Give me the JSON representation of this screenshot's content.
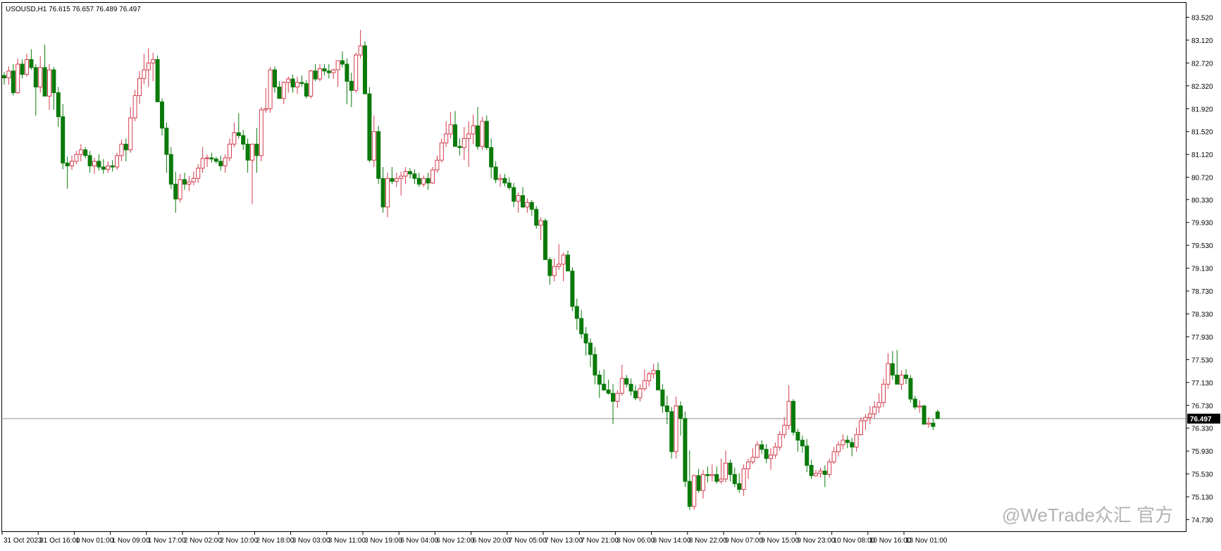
{
  "header": {
    "symbol": "USOUSD,H1",
    "ohlc": "76.615 76.657 76.489 76.497"
  },
  "watermark": {
    "text": "@WeTrade众汇 官方"
  },
  "colors": {
    "bull": "#d33a4b",
    "bear": "#0a7a0a",
    "axis": "#000000",
    "price_line": "#8c8c8c",
    "price_label_bg": "#000000",
    "price_label_fg": "#ffffff"
  },
  "chart_data": {
    "type": "candlestick",
    "title": "USOUSD,H1",
    "ylim": [
      74.73,
      83.52
    ],
    "yticks": [
      "83.520",
      "83.120",
      "82.720",
      "82.320",
      "81.920",
      "81.520",
      "81.120",
      "80.720",
      "80.330",
      "79.930",
      "79.530",
      "79.130",
      "78.730",
      "78.330",
      "77.930",
      "77.530",
      "77.130",
      "76.730",
      "76.330",
      "75.930",
      "75.530",
      "75.130",
      "74.730"
    ],
    "xticks": [
      {
        "label": "31 Oct 2023",
        "index": 0
      },
      {
        "label": "31 Oct 16:00",
        "index": 8
      },
      {
        "label": "1 Nov 01:00",
        "index": 16
      },
      {
        "label": "1 Nov 09:00",
        "index": 24
      },
      {
        "label": "1 Nov 17:00",
        "index": 32
      },
      {
        "label": "2 Nov 02:00",
        "index": 40
      },
      {
        "label": "2 Nov 10:00",
        "index": 48
      },
      {
        "label": "2 Nov 18:00",
        "index": 56
      },
      {
        "label": "3 Nov 03:00",
        "index": 64
      },
      {
        "label": "3 Nov 11:00",
        "index": 72
      },
      {
        "label": "3 Nov 19:00",
        "index": 80
      },
      {
        "label": "6 Nov 04:00",
        "index": 88
      },
      {
        "label": "6 Nov 12:00",
        "index": 96
      },
      {
        "label": "6 Nov 20:00",
        "index": 104
      },
      {
        "label": "7 Nov 05:00",
        "index": 112
      },
      {
        "label": "7 Nov 13:00",
        "index": 120
      },
      {
        "label": "7 Nov 21:00",
        "index": 128
      },
      {
        "label": "8 Nov 06:00",
        "index": 136
      },
      {
        "label": "8 Nov 14:00",
        "index": 144
      },
      {
        "label": "8 Nov 22:00",
        "index": 152
      },
      {
        "label": "9 Nov 07:00",
        "index": 160
      },
      {
        "label": "9 Nov 15:00",
        "index": 168
      },
      {
        "label": "9 Nov 23:00",
        "index": 176
      },
      {
        "label": "10 Nov 08:00",
        "index": 184
      },
      {
        "label": "10 Nov 16:00",
        "index": 192
      },
      {
        "label": "13 Nov 01:00",
        "index": 200
      }
    ],
    "last_price": "76.497",
    "candles": [
      [
        82.5,
        82.56,
        82.34,
        82.46
      ],
      [
        82.46,
        82.66,
        82.34,
        82.58
      ],
      [
        82.58,
        82.7,
        82.15,
        82.2
      ],
      [
        82.2,
        82.8,
        82.18,
        82.7
      ],
      [
        82.7,
        82.78,
        82.45,
        82.52
      ],
      [
        82.52,
        82.88,
        82.48,
        82.78
      ],
      [
        82.78,
        82.96,
        82.6,
        82.64
      ],
      [
        82.64,
        82.7,
        81.8,
        82.3
      ],
      [
        82.3,
        82.84,
        82.2,
        82.64
      ],
      [
        82.64,
        83.04,
        82.4,
        82.14
      ],
      [
        82.14,
        82.7,
        81.9,
        82.6
      ],
      [
        82.6,
        82.65,
        81.9,
        82.2
      ],
      [
        82.2,
        82.3,
        81.6,
        81.78
      ],
      [
        81.78,
        82.0,
        80.86,
        80.97
      ],
      [
        80.97,
        81.08,
        80.52,
        80.92
      ],
      [
        80.92,
        81.1,
        80.85,
        81.0
      ],
      [
        81.0,
        81.18,
        80.95,
        81.12
      ],
      [
        81.12,
        81.3,
        81.0,
        81.2
      ],
      [
        81.2,
        81.25,
        81.05,
        81.1
      ],
      [
        81.1,
        81.18,
        80.8,
        80.92
      ],
      [
        80.92,
        81.06,
        80.78,
        81.0
      ],
      [
        81.0,
        81.12,
        80.84,
        80.9
      ],
      [
        80.9,
        81.04,
        80.78,
        80.86
      ],
      [
        80.86,
        81.0,
        80.8,
        80.92
      ],
      [
        80.92,
        81.02,
        80.82,
        80.9
      ],
      [
        80.9,
        81.15,
        80.85,
        81.1
      ],
      [
        81.1,
        81.38,
        81.0,
        81.3
      ],
      [
        81.3,
        81.4,
        81.0,
        81.2
      ],
      [
        81.2,
        81.95,
        81.15,
        81.76
      ],
      [
        81.76,
        82.25,
        81.7,
        82.15
      ],
      [
        82.15,
        82.58,
        82.0,
        82.45
      ],
      [
        82.45,
        82.88,
        82.35,
        82.6
      ],
      [
        82.6,
        82.98,
        82.3,
        82.72
      ],
      [
        82.72,
        82.9,
        82.4,
        82.78
      ],
      [
        82.78,
        82.85,
        82.05,
        82.04
      ],
      [
        82.04,
        82.1,
        81.45,
        81.58
      ],
      [
        81.58,
        81.68,
        80.8,
        81.12
      ],
      [
        81.12,
        81.25,
        80.52,
        80.6
      ],
      [
        80.6,
        80.82,
        80.1,
        80.34
      ],
      [
        80.34,
        80.78,
        80.28,
        80.68
      ],
      [
        80.68,
        80.8,
        80.5,
        80.6
      ],
      [
        80.6,
        80.74,
        80.48,
        80.64
      ],
      [
        80.64,
        80.82,
        80.58,
        80.7
      ],
      [
        80.7,
        80.95,
        80.62,
        80.88
      ],
      [
        80.88,
        81.25,
        80.8,
        81.05
      ],
      [
        81.05,
        81.12,
        80.9,
        81.06
      ],
      [
        81.06,
        81.15,
        80.98,
        81.04
      ],
      [
        81.04,
        81.08,
        80.96,
        81.0
      ],
      [
        81.0,
        81.1,
        80.84,
        80.92
      ],
      [
        80.92,
        81.12,
        80.8,
        81.06
      ],
      [
        81.06,
        81.4,
        81.0,
        81.3
      ],
      [
        81.3,
        81.68,
        81.25,
        81.5
      ],
      [
        81.5,
        81.84,
        81.4,
        81.45
      ],
      [
        81.45,
        81.55,
        81.2,
        81.3
      ],
      [
        81.3,
        81.4,
        80.8,
        81.02
      ],
      [
        81.02,
        81.12,
        80.25,
        81.3
      ],
      [
        81.3,
        81.58,
        80.8,
        81.1
      ],
      [
        81.1,
        81.95,
        81.0,
        81.9
      ],
      [
        81.9,
        82.28,
        81.85,
        81.92
      ],
      [
        81.92,
        82.65,
        81.85,
        82.6
      ],
      [
        82.6,
        82.66,
        82.2,
        82.3
      ],
      [
        82.3,
        82.4,
        82.1,
        82.1
      ],
      [
        82.1,
        82.4,
        82.0,
        82.38
      ],
      [
        82.38,
        82.48,
        82.2,
        82.44
      ],
      [
        82.44,
        82.52,
        82.2,
        82.3
      ],
      [
        82.3,
        82.48,
        82.18,
        82.38
      ],
      [
        82.38,
        82.5,
        82.3,
        82.36
      ],
      [
        82.36,
        82.42,
        82.1,
        82.14
      ],
      [
        82.14,
        82.6,
        82.1,
        82.58
      ],
      [
        82.58,
        82.7,
        82.4,
        82.44
      ],
      [
        82.44,
        82.7,
        82.4,
        82.62
      ],
      [
        82.62,
        82.7,
        82.5,
        82.58
      ],
      [
        82.58,
        82.7,
        82.45,
        82.55
      ],
      [
        82.55,
        82.62,
        82.44,
        82.6
      ],
      [
        82.6,
        82.75,
        82.3,
        82.76
      ],
      [
        82.76,
        82.92,
        82.64,
        82.7
      ],
      [
        82.7,
        82.8,
        82.0,
        82.4
      ],
      [
        82.4,
        82.55,
        81.95,
        82.24
      ],
      [
        82.24,
        82.9,
        82.2,
        82.86
      ],
      [
        82.86,
        83.3,
        82.8,
        83.02
      ],
      [
        83.02,
        83.1,
        82.4,
        82.18
      ],
      [
        82.18,
        82.3,
        80.98,
        81.02
      ],
      [
        81.02,
        81.8,
        80.9,
        81.52
      ],
      [
        81.52,
        81.62,
        80.6,
        80.7
      ],
      [
        80.7,
        80.9,
        80.1,
        80.2
      ],
      [
        80.2,
        80.8,
        80.02,
        80.7
      ],
      [
        80.7,
        80.9,
        80.6,
        80.65
      ],
      [
        80.65,
        80.8,
        80.55,
        80.7
      ],
      [
        80.7,
        80.82,
        80.4,
        80.74
      ],
      [
        80.74,
        80.9,
        80.6,
        80.82
      ],
      [
        80.82,
        80.88,
        80.7,
        80.78
      ],
      [
        80.78,
        80.86,
        80.6,
        80.7
      ],
      [
        80.7,
        80.8,
        80.55,
        80.6
      ],
      [
        80.6,
        80.75,
        80.55,
        80.7
      ],
      [
        80.7,
        80.8,
        80.5,
        80.62
      ],
      [
        80.62,
        80.9,
        80.6,
        80.85
      ],
      [
        80.85,
        81.1,
        80.8,
        81.02
      ],
      [
        81.02,
        81.4,
        80.98,
        81.32
      ],
      [
        81.32,
        81.7,
        81.25,
        81.48
      ],
      [
        81.48,
        81.86,
        81.4,
        81.64
      ],
      [
        81.64,
        81.88,
        81.5,
        81.26
      ],
      [
        81.26,
        81.4,
        81.1,
        81.24
      ],
      [
        81.24,
        81.6,
        81.02,
        81.4
      ],
      [
        81.4,
        81.7,
        80.9,
        81.48
      ],
      [
        81.48,
        81.82,
        81.3,
        81.62
      ],
      [
        81.62,
        81.95,
        81.2,
        81.26
      ],
      [
        81.26,
        81.78,
        81.2,
        81.7
      ],
      [
        81.7,
        81.8,
        81.2,
        81.24
      ],
      [
        81.24,
        81.4,
        80.7,
        80.9
      ],
      [
        80.9,
        81.0,
        80.62,
        80.68
      ],
      [
        80.68,
        80.78,
        80.55,
        80.7
      ],
      [
        80.7,
        80.78,
        80.56,
        80.62
      ],
      [
        80.62,
        80.72,
        80.5,
        80.54
      ],
      [
        80.54,
        80.62,
        80.2,
        80.3
      ],
      [
        80.3,
        80.45,
        80.1,
        80.4
      ],
      [
        80.4,
        80.55,
        80.18,
        80.2
      ],
      [
        80.2,
        80.35,
        80.1,
        80.28
      ],
      [
        80.28,
        80.32,
        80.05,
        80.16
      ],
      [
        80.16,
        80.22,
        79.82,
        79.88
      ],
      [
        79.88,
        80.02,
        79.62,
        79.96
      ],
      [
        79.96,
        80.0,
        79.5,
        79.28
      ],
      [
        79.28,
        79.32,
        78.84,
        79.0
      ],
      [
        79.0,
        79.3,
        78.9,
        79.16
      ],
      [
        79.16,
        79.55,
        79.1,
        79.2
      ],
      [
        79.2,
        79.4,
        78.9,
        79.36
      ],
      [
        79.36,
        79.44,
        79.12,
        79.08
      ],
      [
        79.08,
        79.15,
        78.38,
        78.46
      ],
      [
        78.46,
        78.6,
        78.05,
        78.25
      ],
      [
        78.25,
        78.4,
        77.9,
        77.98
      ],
      [
        77.98,
        78.1,
        77.6,
        77.82
      ],
      [
        77.82,
        77.9,
        77.4,
        77.62
      ],
      [
        77.62,
        77.75,
        77.1,
        77.26
      ],
      [
        77.26,
        77.34,
        76.86,
        77.1
      ],
      [
        77.1,
        77.36,
        76.98,
        77.0
      ],
      [
        77.0,
        77.18,
        76.92,
        76.94
      ],
      [
        76.94,
        77.1,
        76.4,
        76.8
      ],
      [
        76.8,
        77.0,
        76.68,
        76.94
      ],
      [
        76.94,
        77.44,
        76.9,
        77.2
      ],
      [
        77.2,
        77.26,
        77.04,
        77.1
      ],
      [
        77.1,
        77.2,
        76.9,
        76.98
      ],
      [
        76.98,
        77.08,
        76.82,
        76.86
      ],
      [
        76.86,
        77.1,
        76.8,
        77.02
      ],
      [
        77.02,
        77.36,
        76.98,
        77.16
      ],
      [
        77.16,
        77.32,
        77.06,
        77.28
      ],
      [
        77.28,
        77.46,
        77.2,
        77.34
      ],
      [
        77.34,
        77.48,
        77.0,
        77.0
      ],
      [
        77.0,
        77.1,
        76.6,
        76.72
      ],
      [
        76.72,
        76.9,
        76.4,
        76.62
      ],
      [
        76.62,
        76.7,
        75.8,
        75.92
      ],
      [
        75.92,
        76.88,
        75.8,
        76.72
      ],
      [
        76.72,
        76.8,
        76.2,
        76.5
      ],
      [
        76.5,
        76.62,
        75.3,
        75.4
      ],
      [
        75.4,
        75.94,
        74.9,
        74.96
      ],
      [
        74.96,
        75.52,
        74.9,
        75.5
      ],
      [
        75.5,
        75.62,
        75.2,
        75.24
      ],
      [
        75.24,
        75.6,
        75.1,
        75.52
      ],
      [
        75.52,
        75.66,
        75.38,
        75.5
      ],
      [
        75.5,
        75.7,
        75.4,
        75.52
      ],
      [
        75.52,
        75.66,
        75.36,
        75.4
      ],
      [
        75.4,
        75.8,
        75.36,
        75.44
      ],
      [
        75.44,
        75.94,
        75.38,
        75.72
      ],
      [
        75.72,
        75.78,
        75.4,
        75.52
      ],
      [
        75.52,
        75.64,
        75.3,
        75.36
      ],
      [
        75.36,
        75.54,
        75.2,
        75.26
      ],
      [
        75.26,
        75.7,
        75.15,
        75.62
      ],
      [
        75.62,
        75.8,
        75.44,
        75.74
      ],
      [
        75.74,
        75.98,
        75.7,
        75.82
      ],
      [
        75.82,
        76.1,
        75.8,
        76.04
      ],
      [
        76.04,
        76.12,
        75.88,
        75.96
      ],
      [
        75.96,
        76.05,
        75.72,
        75.8
      ],
      [
        75.8,
        75.98,
        75.6,
        75.86
      ],
      [
        75.86,
        76.08,
        75.8,
        76.0
      ],
      [
        76.0,
        76.28,
        75.94,
        76.22
      ],
      [
        76.22,
        76.52,
        76.15,
        76.38
      ],
      [
        76.38,
        77.08,
        76.3,
        76.8
      ],
      [
        76.8,
        76.84,
        76.2,
        76.26
      ],
      [
        76.26,
        76.32,
        75.92,
        76.12
      ],
      [
        76.12,
        76.2,
        75.9,
        76.02
      ],
      [
        76.02,
        76.14,
        75.56,
        75.68
      ],
      [
        75.68,
        75.78,
        75.44,
        75.5
      ],
      [
        75.5,
        75.6,
        75.48,
        75.54
      ],
      [
        75.54,
        75.64,
        75.46,
        75.58
      ],
      [
        75.58,
        75.68,
        75.3,
        75.52
      ],
      [
        75.52,
        75.8,
        75.46,
        75.74
      ],
      [
        75.74,
        76.0,
        75.7,
        75.92
      ],
      [
        75.92,
        76.1,
        75.84,
        76.04
      ],
      [
        76.04,
        76.22,
        75.96,
        76.12
      ],
      [
        76.12,
        76.2,
        75.98,
        76.08
      ],
      [
        76.08,
        76.16,
        75.84,
        76.0
      ],
      [
        76.0,
        76.34,
        75.92,
        76.22
      ],
      [
        76.22,
        76.52,
        76.2,
        76.46
      ],
      [
        76.46,
        76.58,
        76.3,
        76.52
      ],
      [
        76.52,
        76.72,
        76.4,
        76.58
      ],
      [
        76.58,
        76.8,
        76.5,
        76.7
      ],
      [
        76.7,
        76.94,
        76.6,
        76.78
      ],
      [
        76.78,
        77.2,
        76.7,
        77.1
      ],
      [
        77.1,
        77.64,
        77.02,
        77.46
      ],
      [
        77.46,
        77.68,
        77.18,
        77.26
      ],
      [
        77.26,
        77.7,
        77.1,
        77.1
      ],
      [
        77.1,
        77.34,
        77.0,
        77.26
      ],
      [
        77.26,
        77.36,
        77.1,
        77.2
      ],
      [
        77.2,
        77.26,
        76.78,
        76.84
      ],
      [
        76.84,
        76.9,
        76.66,
        76.7
      ],
      [
        76.7,
        76.82,
        76.6,
        76.72
      ],
      [
        76.72,
        76.74,
        76.4,
        76.4
      ],
      [
        76.4,
        76.52,
        76.34,
        76.42
      ],
      [
        76.42,
        76.5,
        76.3,
        76.36
      ],
      [
        76.615,
        76.657,
        76.489,
        76.497
      ]
    ]
  }
}
